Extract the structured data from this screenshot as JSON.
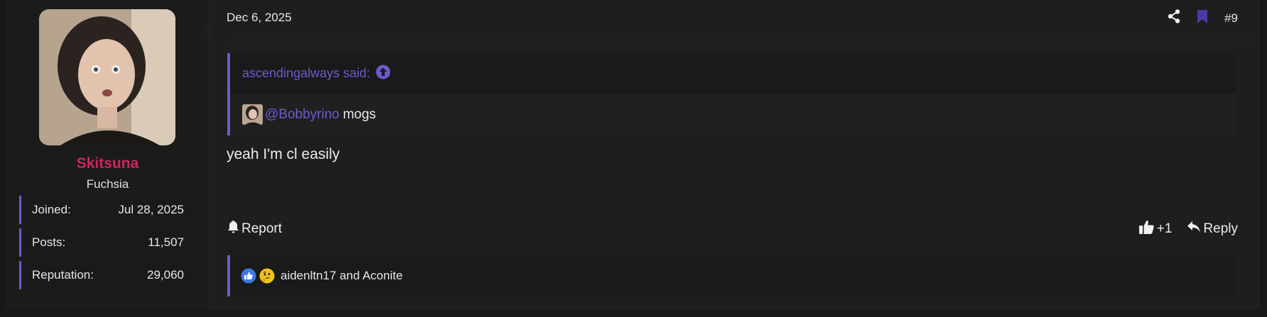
{
  "user": {
    "username": "Skitsuna",
    "title": "Fuchsia",
    "stats": [
      {
        "label": "Joined:",
        "value": "Jul 28, 2025"
      },
      {
        "label": "Posts:",
        "value": "11,507"
      },
      {
        "label": "Reputation:",
        "value": "29,060"
      }
    ],
    "username_color": "#d0245a"
  },
  "post": {
    "date": "Dec 6, 2025",
    "number": "#9",
    "body": "yeah I'm cl easily"
  },
  "quote": {
    "attribution": "ascendingalways said:",
    "mention": "@Bobbyrino",
    "text": "mogs"
  },
  "actions": {
    "report_label": "Report",
    "like_count": "+1",
    "reply_label": "Reply"
  },
  "reactions": {
    "text": "aidenltn17 and Aconite",
    "icons": [
      "like-reaction-icon",
      "thinking-reaction-icon"
    ]
  },
  "colors": {
    "accent": "#6d5acd",
    "background": "#1e1e1e"
  }
}
